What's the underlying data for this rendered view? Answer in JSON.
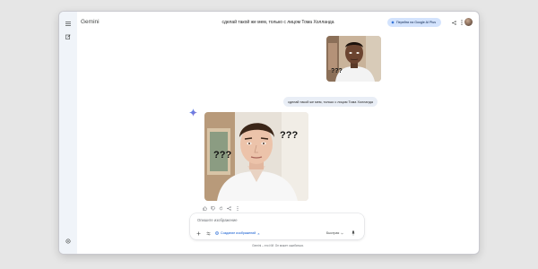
{
  "app": {
    "name": "Gemini"
  },
  "chat": {
    "title": "сделай такой же мем, только с лицом Тома Холланда"
  },
  "upgrade": {
    "label": "Перейти на Google AI Plus"
  },
  "user_message": {
    "text": "сделай такой же мем, только с лицом Тома Холланда",
    "image_text": "???"
  },
  "response": {
    "image_texts": [
      "???",
      "???"
    ]
  },
  "composer": {
    "placeholder": "Опишите изображение",
    "tool_label": "Создание изображений",
    "model_label": "Быстрая"
  },
  "footer": {
    "disclaimer": "Gemini – это ИИ. Он может ошибаться."
  },
  "colors": {
    "accent": "#0b57d0",
    "sidebar": "#f0f4f9",
    "bubble": "#e9eef6",
    "upgrade_bg": "#d3e3fd"
  },
  "icons": {
    "menu": "menu-icon",
    "new_chat": "edit-icon",
    "settings": "gear-icon",
    "spark": "gemini-spark-icon",
    "share": "share-icon",
    "more": "more-vert-icon",
    "add": "plus-icon",
    "tools": "tune-icon",
    "mic": "mic-icon"
  }
}
